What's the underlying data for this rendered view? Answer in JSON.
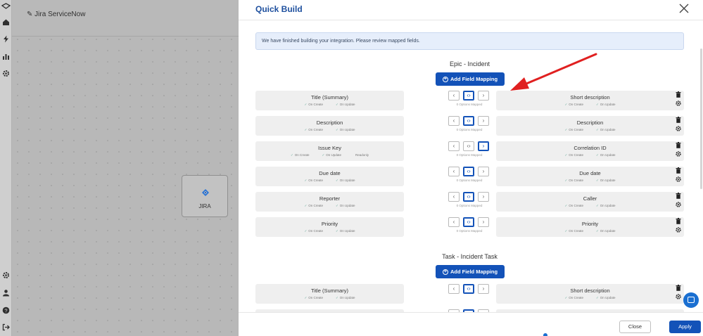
{
  "rail": {
    "icons": [
      "logo-icon",
      "home-icon",
      "bolt-icon",
      "chart-icon",
      "gear-icon",
      "settings-icon",
      "user-icon",
      "help-icon",
      "logout-icon"
    ]
  },
  "background": {
    "title": "Jira ServiceNow",
    "node_label": "JIRA"
  },
  "modal": {
    "title": "Quick Build",
    "info": "We have finished building your integration. Please review mapped fields.",
    "add_mapping_label": "Add Field Mapping",
    "sections": [
      {
        "title": "Epic - Incident",
        "rows": [
          {
            "left": "Title (Summary)",
            "left_opts": [
              "On Create",
              "On Update"
            ],
            "right": "Short description",
            "right_opts": [
              "On Create",
              "On Update"
            ],
            "mapped": "0 Options Mapped",
            "selected": "both"
          },
          {
            "left": "Description",
            "left_opts": [
              "On Create",
              "On Update"
            ],
            "right": "Description",
            "right_opts": [
              "On Create",
              "On Update"
            ],
            "mapped": "0 Options Mapped",
            "selected": "both"
          },
          {
            "left": "Issue Key",
            "left_opts": [
              "On Create",
              "On Update",
              "Readonly"
            ],
            "right": "Correlation ID",
            "right_opts": [
              "On Create",
              "On Update"
            ],
            "mapped": "0 Options Mapped",
            "selected": "right"
          },
          {
            "left": "Due date",
            "left_opts": [
              "On Create",
              "On Update"
            ],
            "right": "Due date",
            "right_opts": [
              "On Create",
              "On Update"
            ],
            "mapped": "0 Options Mapped",
            "selected": "both"
          },
          {
            "left": "Reporter",
            "left_opts": [
              "On Create",
              "On Update"
            ],
            "right": "Caller",
            "right_opts": [
              "On Create",
              "On Update"
            ],
            "mapped": "0 Options Mapped",
            "selected": "both"
          },
          {
            "left": "Priority",
            "left_opts": [
              "On Create",
              "On Update"
            ],
            "right": "Priority",
            "right_opts": [
              "On Create",
              "On Update"
            ],
            "mapped": "0 Options Mapped",
            "selected": "both"
          }
        ]
      },
      {
        "title": "Task - Incident Task",
        "rows": [
          {
            "left": "Title (Summary)",
            "left_opts": [
              "On Create",
              "On Update"
            ],
            "right": "Short description",
            "right_opts": [
              "On Create",
              "On Update"
            ],
            "mapped": "0 Options Mapped",
            "selected": "both"
          }
        ]
      }
    ],
    "buttons": {
      "close": "Close",
      "apply": "Apply"
    }
  },
  "colors": {
    "accent": "#1352b8",
    "title": "#1d4f9e",
    "arrow": "#e02020"
  }
}
